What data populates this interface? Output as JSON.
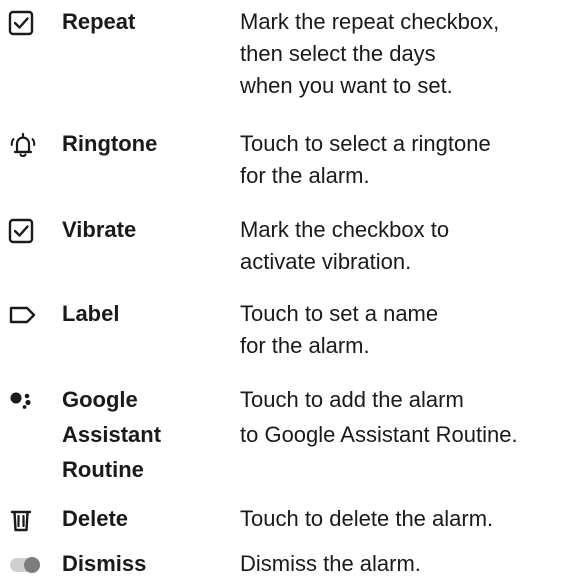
{
  "items": [
    {
      "icon": "checkbox-checked-icon",
      "name": [
        "Repeat"
      ],
      "description": [
        "Mark the repeat checkbox,",
        "then select the days",
        "when you want to set."
      ]
    },
    {
      "icon": "ringtone-bell-icon",
      "name": [
        "Ringtone"
      ],
      "description": [
        "Touch to select a ringtone",
        "for the alarm."
      ]
    },
    {
      "icon": "checkbox-checked-icon",
      "name": [
        "Vibrate"
      ],
      "description": [
        "Mark the checkbox to",
        "activate vibration."
      ]
    },
    {
      "icon": "label-tag-icon",
      "name": [
        "Label"
      ],
      "description": [
        "Touch to set a name",
        "for the alarm."
      ]
    },
    {
      "icon": "google-assistant-icon",
      "name": [
        "Google",
        "Assistant",
        "Routine"
      ],
      "description": [
        "Touch to add the alarm",
        "to Google Assistant Routine."
      ]
    },
    {
      "icon": "trash-icon",
      "name": [
        "Delete"
      ],
      "description": [
        "Touch to delete the alarm."
      ]
    },
    {
      "icon": "toggle-switch-icon",
      "name": [
        "Dismiss"
      ],
      "description": [
        "Dismiss the alarm."
      ]
    }
  ]
}
